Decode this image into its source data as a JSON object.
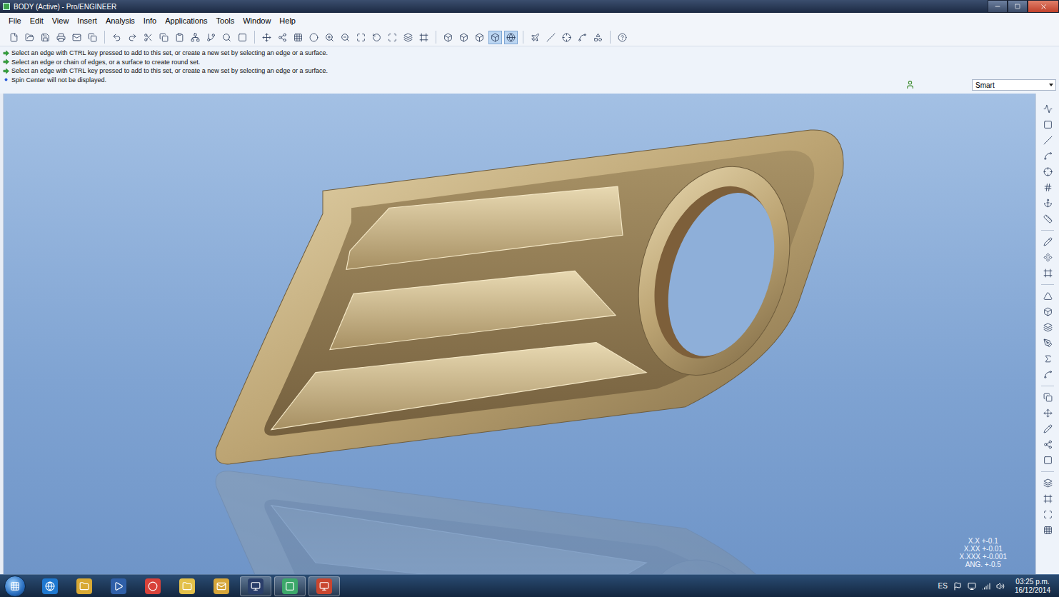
{
  "window": {
    "title": "BODY (Active) - Pro/ENGINEER"
  },
  "menu": [
    "File",
    "Edit",
    "View",
    "Insert",
    "Analysis",
    "Info",
    "Applications",
    "Tools",
    "Window",
    "Help"
  ],
  "messages": [
    {
      "kind": "prompt",
      "text": "Select an edge with CTRL key pressed to add to this set, or create a new set by selecting an edge or a surface."
    },
    {
      "kind": "prompt",
      "text": "Select an edge or chain of edges, or a surface to create round set."
    },
    {
      "kind": "prompt",
      "text": "Select an edge with CTRL key pressed to add to this set, or create a new set by selecting an edge or a surface."
    },
    {
      "kind": "info",
      "text": "Spin Center will not be displayed."
    }
  ],
  "filter": {
    "value": "Smart"
  },
  "tolerances": [
    "X.X +-0.1",
    "X.XX +-0.01",
    "X.XXX +-0.001",
    "ANG. +-0.5"
  ],
  "taskbar": {
    "apps": [
      {
        "running": false
      },
      {
        "running": false
      },
      {
        "running": false
      },
      {
        "running": false
      },
      {
        "running": false
      },
      {
        "running": false
      },
      {
        "running": true
      },
      {
        "running": true
      },
      {
        "running": true
      }
    ],
    "language": "ES",
    "time": "03:25 p.m.",
    "date": "16/12/2014"
  }
}
